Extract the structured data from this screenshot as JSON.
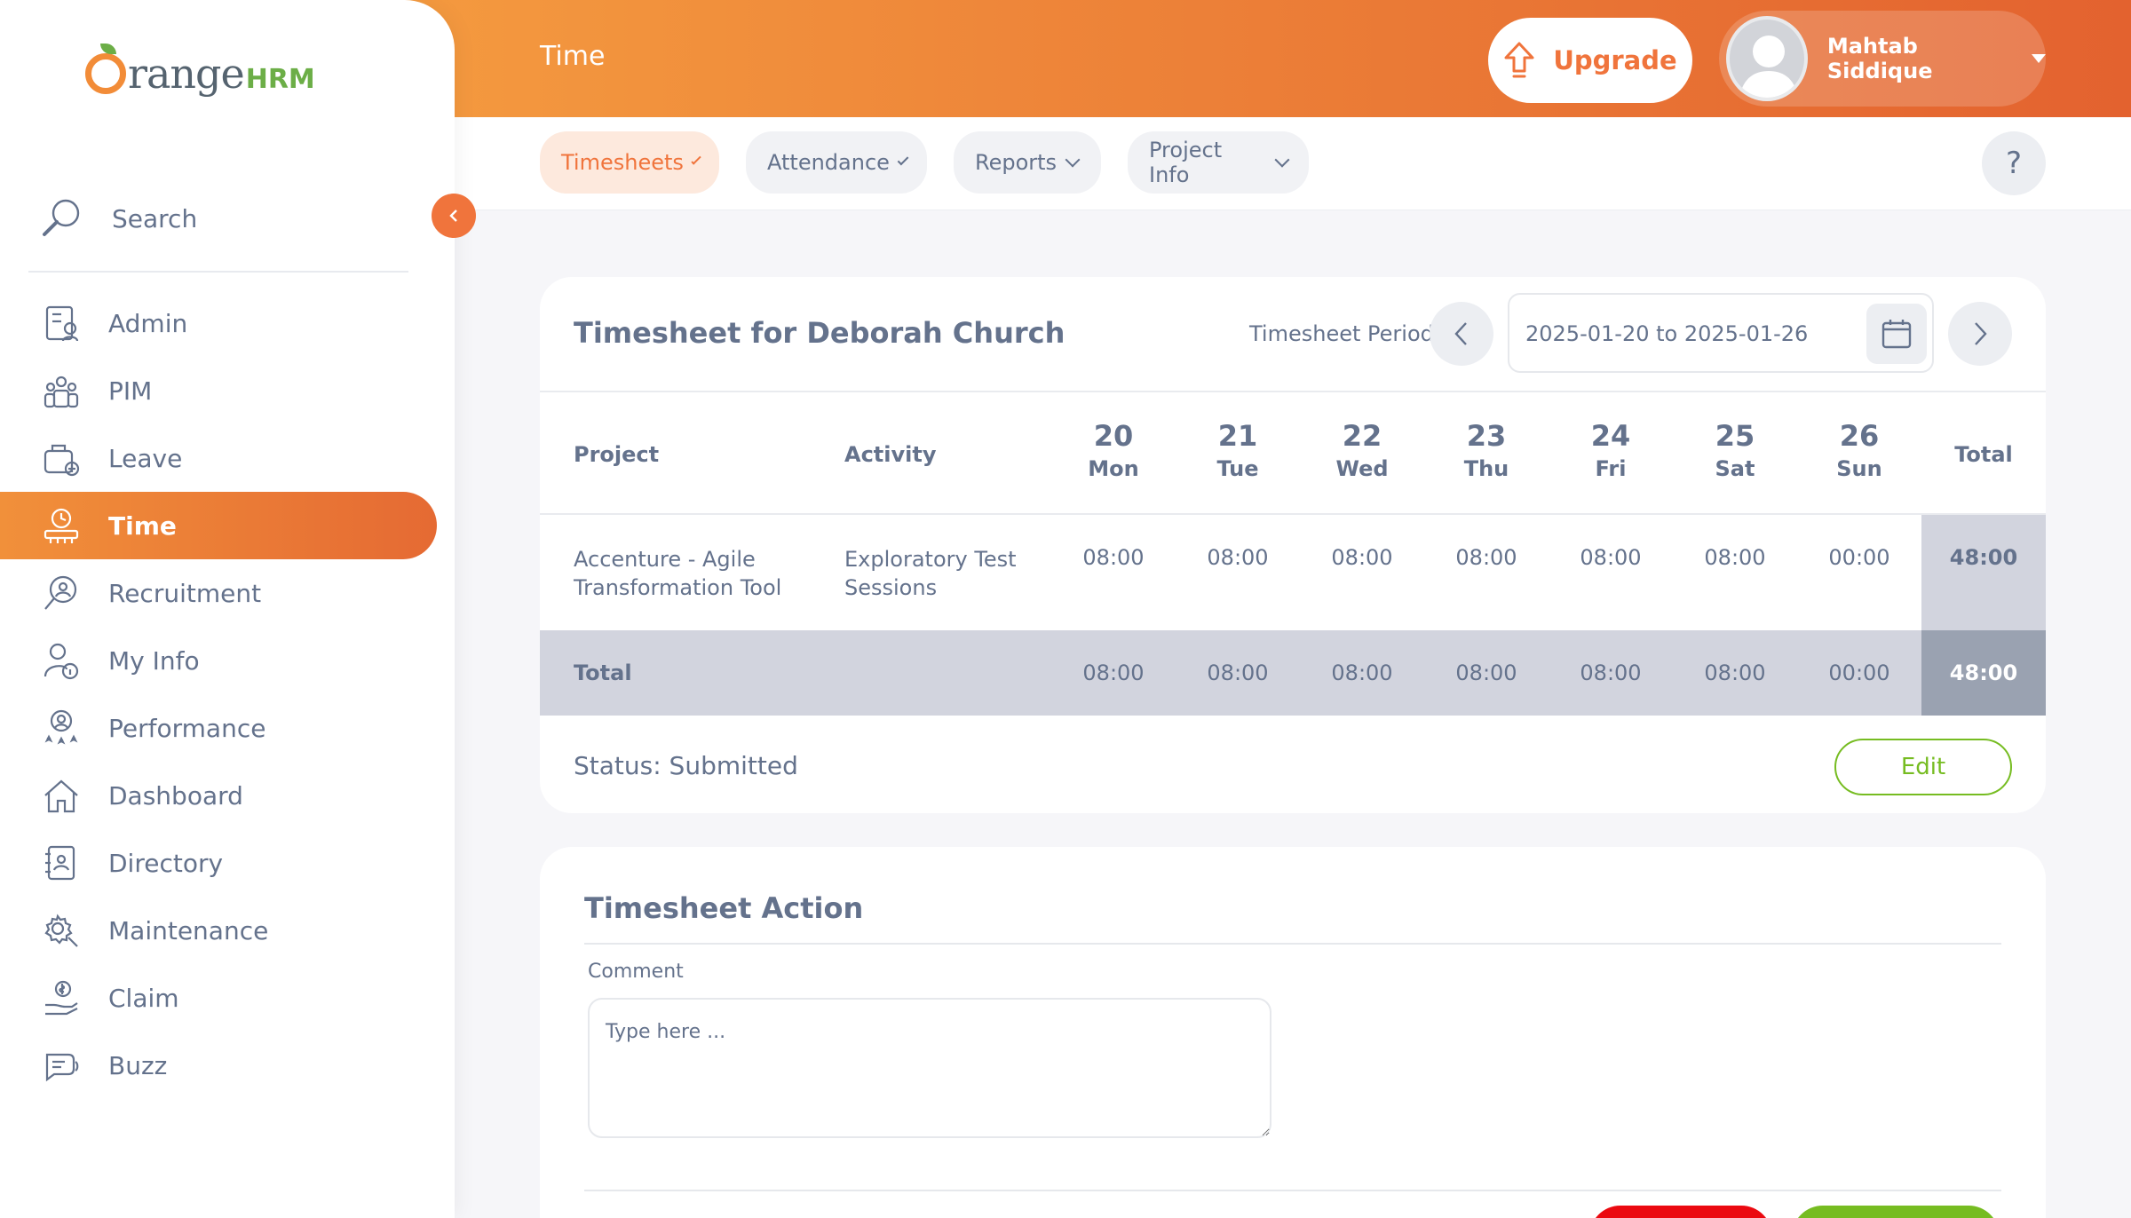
{
  "brand": {
    "name": "rangeHRM",
    "letter": "O",
    "hrm": "HRM",
    "prefix": "range"
  },
  "topbar": {
    "module_title": "Time",
    "upgrade_label": "Upgrade",
    "user_name": "Mahtab Siddique"
  },
  "sidebar": {
    "search_label": "Search",
    "items": [
      {
        "label": "Admin",
        "icon": "admin-icon"
      },
      {
        "label": "PIM",
        "icon": "pim-icon"
      },
      {
        "label": "Leave",
        "icon": "leave-icon"
      },
      {
        "label": "Time",
        "icon": "time-icon",
        "active": true
      },
      {
        "label": "Recruitment",
        "icon": "recruitment-icon"
      },
      {
        "label": "My Info",
        "icon": "my-info-icon"
      },
      {
        "label": "Performance",
        "icon": "performance-icon"
      },
      {
        "label": "Dashboard",
        "icon": "dashboard-icon"
      },
      {
        "label": "Directory",
        "icon": "directory-icon"
      },
      {
        "label": "Maintenance",
        "icon": "maintenance-icon"
      },
      {
        "label": "Claim",
        "icon": "claim-icon"
      },
      {
        "label": "Buzz",
        "icon": "buzz-icon"
      }
    ]
  },
  "subnav": {
    "tabs": [
      {
        "label": "Timesheets",
        "active": true
      },
      {
        "label": "Attendance"
      },
      {
        "label": "Reports"
      },
      {
        "label": "Project Info"
      }
    ],
    "help_label": "?"
  },
  "timesheet": {
    "title": "Timesheet for Deborah Church",
    "period_label": "Timesheet Period",
    "period_value": "2025-01-20 to 2025-01-26",
    "columns": {
      "project": "Project",
      "activity": "Activity",
      "total": "Total",
      "days": [
        {
          "num": "20",
          "name": "Mon"
        },
        {
          "num": "21",
          "name": "Tue"
        },
        {
          "num": "22",
          "name": "Wed"
        },
        {
          "num": "23",
          "name": "Thu"
        },
        {
          "num": "24",
          "name": "Fri"
        },
        {
          "num": "25",
          "name": "Sat"
        },
        {
          "num": "26",
          "name": "Sun"
        }
      ]
    },
    "rows": [
      {
        "project_line1": "Accenture - Agile",
        "project_line2": "Transformation Tool",
        "activity_line1": "Exploratory Test",
        "activity_line2": "Sessions",
        "hours": [
          "08:00",
          "08:00",
          "08:00",
          "08:00",
          "08:00",
          "08:00",
          "00:00"
        ],
        "total": "48:00"
      }
    ],
    "totals": {
      "label": "Total",
      "hours": [
        "08:00",
        "08:00",
        "08:00",
        "08:00",
        "08:00",
        "08:00",
        "00:00"
      ],
      "total": "48:00"
    },
    "status": "Status: Submitted",
    "edit_label": "Edit"
  },
  "action": {
    "title": "Timesheet Action",
    "comment_label": "Comment",
    "comment_placeholder": "Type here ...",
    "comment_value": ""
  },
  "colors": {
    "accent": "#f0743c",
    "gradient_start": "#f6a041",
    "gradient_end": "#e3622f",
    "success": "#76bc21",
    "danger": "#eb0910",
    "text": "#64728c"
  }
}
